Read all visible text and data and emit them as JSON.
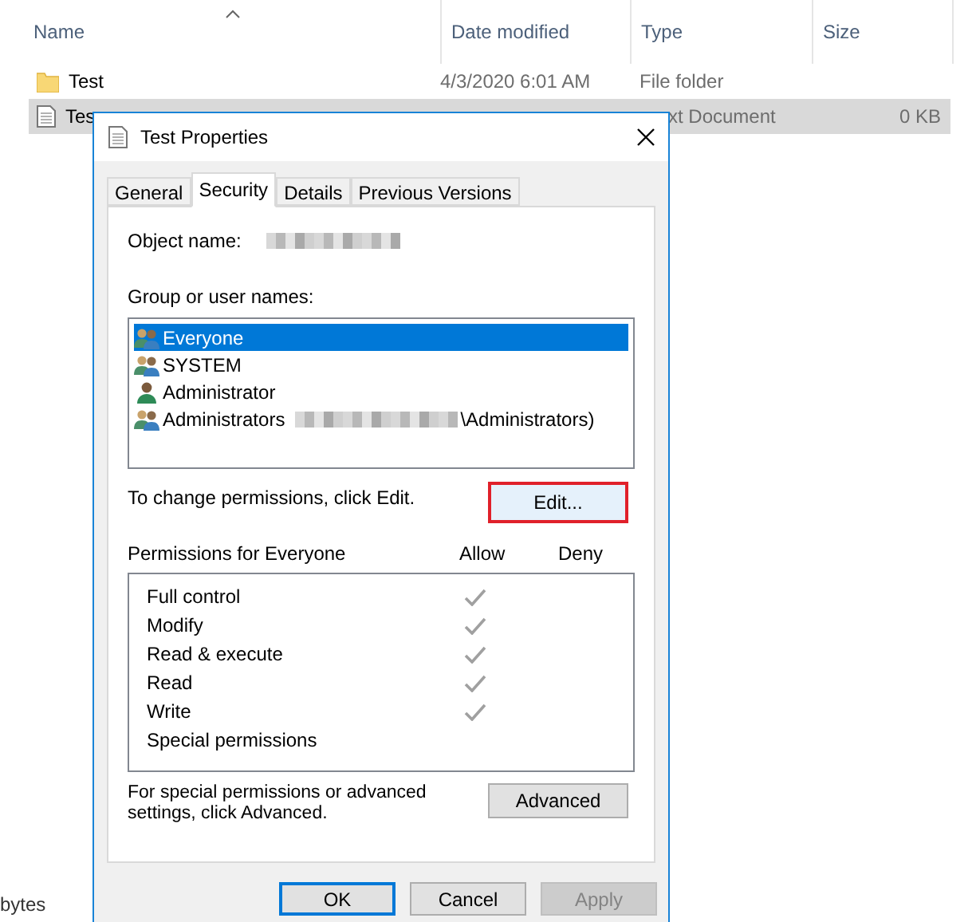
{
  "explorer": {
    "columns": [
      "Name",
      "Date modified",
      "Type",
      "Size"
    ],
    "rows": [
      {
        "kind": "folder",
        "name": "Test",
        "date": "4/3/2020 6:01 AM",
        "type": "File folder",
        "selected": false
      },
      {
        "kind": "file",
        "name": "Tes",
        "type": "xt Document",
        "size": "0 KB",
        "selected": true
      }
    ],
    "status_bar": "bytes"
  },
  "dialog": {
    "title": "Test Properties",
    "tabs": [
      {
        "label": "General",
        "selected": false
      },
      {
        "label": "Security",
        "selected": true
      },
      {
        "label": "Details",
        "selected": false
      },
      {
        "label": "Previous Versions",
        "selected": false
      }
    ],
    "object_name_label": "Object name:",
    "groups_label": "Group or user names:",
    "groups": [
      {
        "kind": "group",
        "name": "Everyone",
        "selected": true
      },
      {
        "kind": "group",
        "name": "SYSTEM",
        "selected": false
      },
      {
        "kind": "user",
        "name": "Administrator",
        "selected": false
      },
      {
        "kind": "group",
        "name": "Administrators",
        "suffix": "\\Administrators)",
        "redacted": true,
        "selected": false
      }
    ],
    "change_hint": "To change permissions, click Edit.",
    "edit_button": {
      "label": "Edit...",
      "highlighted": true
    },
    "permissions_label": "Permissions for Everyone",
    "allow_label": "Allow",
    "deny_label": "Deny",
    "permissions": [
      {
        "name": "Full control",
        "allow": true,
        "deny": false
      },
      {
        "name": "Modify",
        "allow": true,
        "deny": false
      },
      {
        "name": "Read & execute",
        "allow": true,
        "deny": false
      },
      {
        "name": "Read",
        "allow": true,
        "deny": false
      },
      {
        "name": "Write",
        "allow": true,
        "deny": false
      },
      {
        "name": "Special permissions",
        "allow": false,
        "deny": false
      }
    ],
    "advanced_hint": "For special permissions or advanced settings, click Advanced.",
    "advanced_button": "Advanced",
    "buttons": [
      {
        "label": "OK",
        "kind": "default",
        "disabled": false
      },
      {
        "label": "Cancel",
        "kind": "normal",
        "disabled": false
      },
      {
        "label": "Apply",
        "kind": "normal",
        "disabled": true
      }
    ]
  }
}
